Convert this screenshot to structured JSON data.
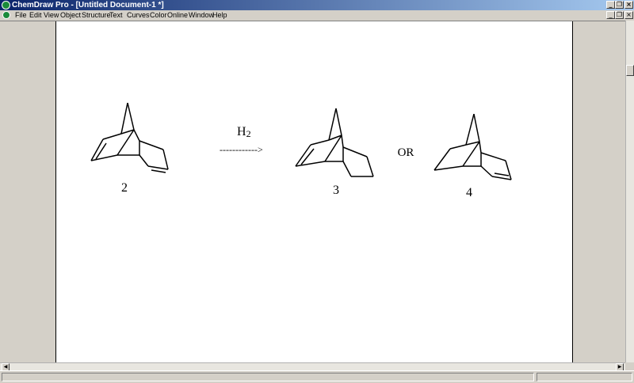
{
  "window": {
    "title": "ChemDraw Pro - [Untitled Document-1 *]",
    "min_glyph": "_",
    "restore_glyph": "❐",
    "close_glyph": "×"
  },
  "menubar": {
    "items": [
      {
        "label": "File"
      },
      {
        "label": "Edit"
      },
      {
        "label": "View"
      },
      {
        "label": "Object"
      },
      {
        "label": "Structure"
      },
      {
        "label": "Text"
      },
      {
        "label": "Curves"
      },
      {
        "label": "Color"
      },
      {
        "label": "Online"
      },
      {
        "label": "Window"
      },
      {
        "label": "Help"
      }
    ]
  },
  "drawing": {
    "compound_2_label": "2",
    "reagent": "H",
    "reagent_subscript": "2",
    "arrow_text": "------------>",
    "compound_3_label": "3",
    "or_text": "OR",
    "compound_4_label": "4"
  },
  "scroll_glyphs": {
    "left": "◀",
    "right": "▶"
  }
}
